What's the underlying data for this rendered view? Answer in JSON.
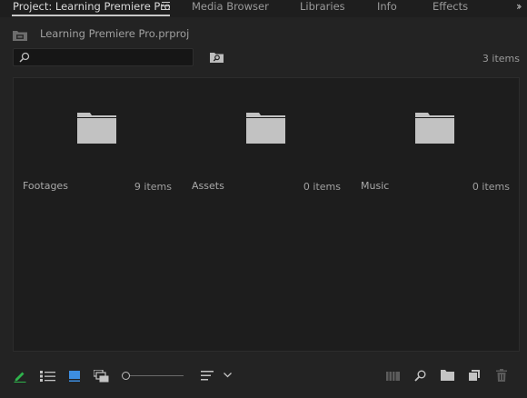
{
  "tabs": [
    {
      "label": "Project: Learning Premiere Pro",
      "active": true
    },
    {
      "label": "Media Browser",
      "active": false
    },
    {
      "label": "Libraries",
      "active": false
    },
    {
      "label": "Info",
      "active": false
    },
    {
      "label": "Effects",
      "active": false
    }
  ],
  "overflow_icon": "chevron-double-right-icon",
  "tab_menu_icon": "hamburger-menu-icon",
  "project": {
    "icon": "project-bin-icon",
    "filename": "Learning Premiere Pro.prproj"
  },
  "search": {
    "placeholder": "",
    "value": "",
    "icon": "search-icon",
    "bin_search_icon": "new-search-bin-icon"
  },
  "item_count": "3 items",
  "bins": [
    {
      "name": "Footages",
      "count": "9 items",
      "icon": "folder-icon"
    },
    {
      "name": "Assets",
      "count": "0 items",
      "icon": "folder-icon"
    },
    {
      "name": "Music",
      "count": "0 items",
      "icon": "folder-icon"
    }
  ],
  "toolbar": {
    "left": [
      "pencil-icon",
      "list-view-icon",
      "icon-view-icon",
      "freeform-view-icon"
    ],
    "zoom_level": 0.0,
    "sort": [
      "sort-icon",
      "chevron-down-icon"
    ],
    "right": [
      "automate-to-sequence-icon",
      "find-icon",
      "new-bin-icon",
      "new-item-icon",
      "clear-trash-icon"
    ]
  },
  "colors": {
    "active_pencil": "#2fb34c",
    "active_view": "#3d8ee0",
    "folder": "#c2c2c2"
  }
}
